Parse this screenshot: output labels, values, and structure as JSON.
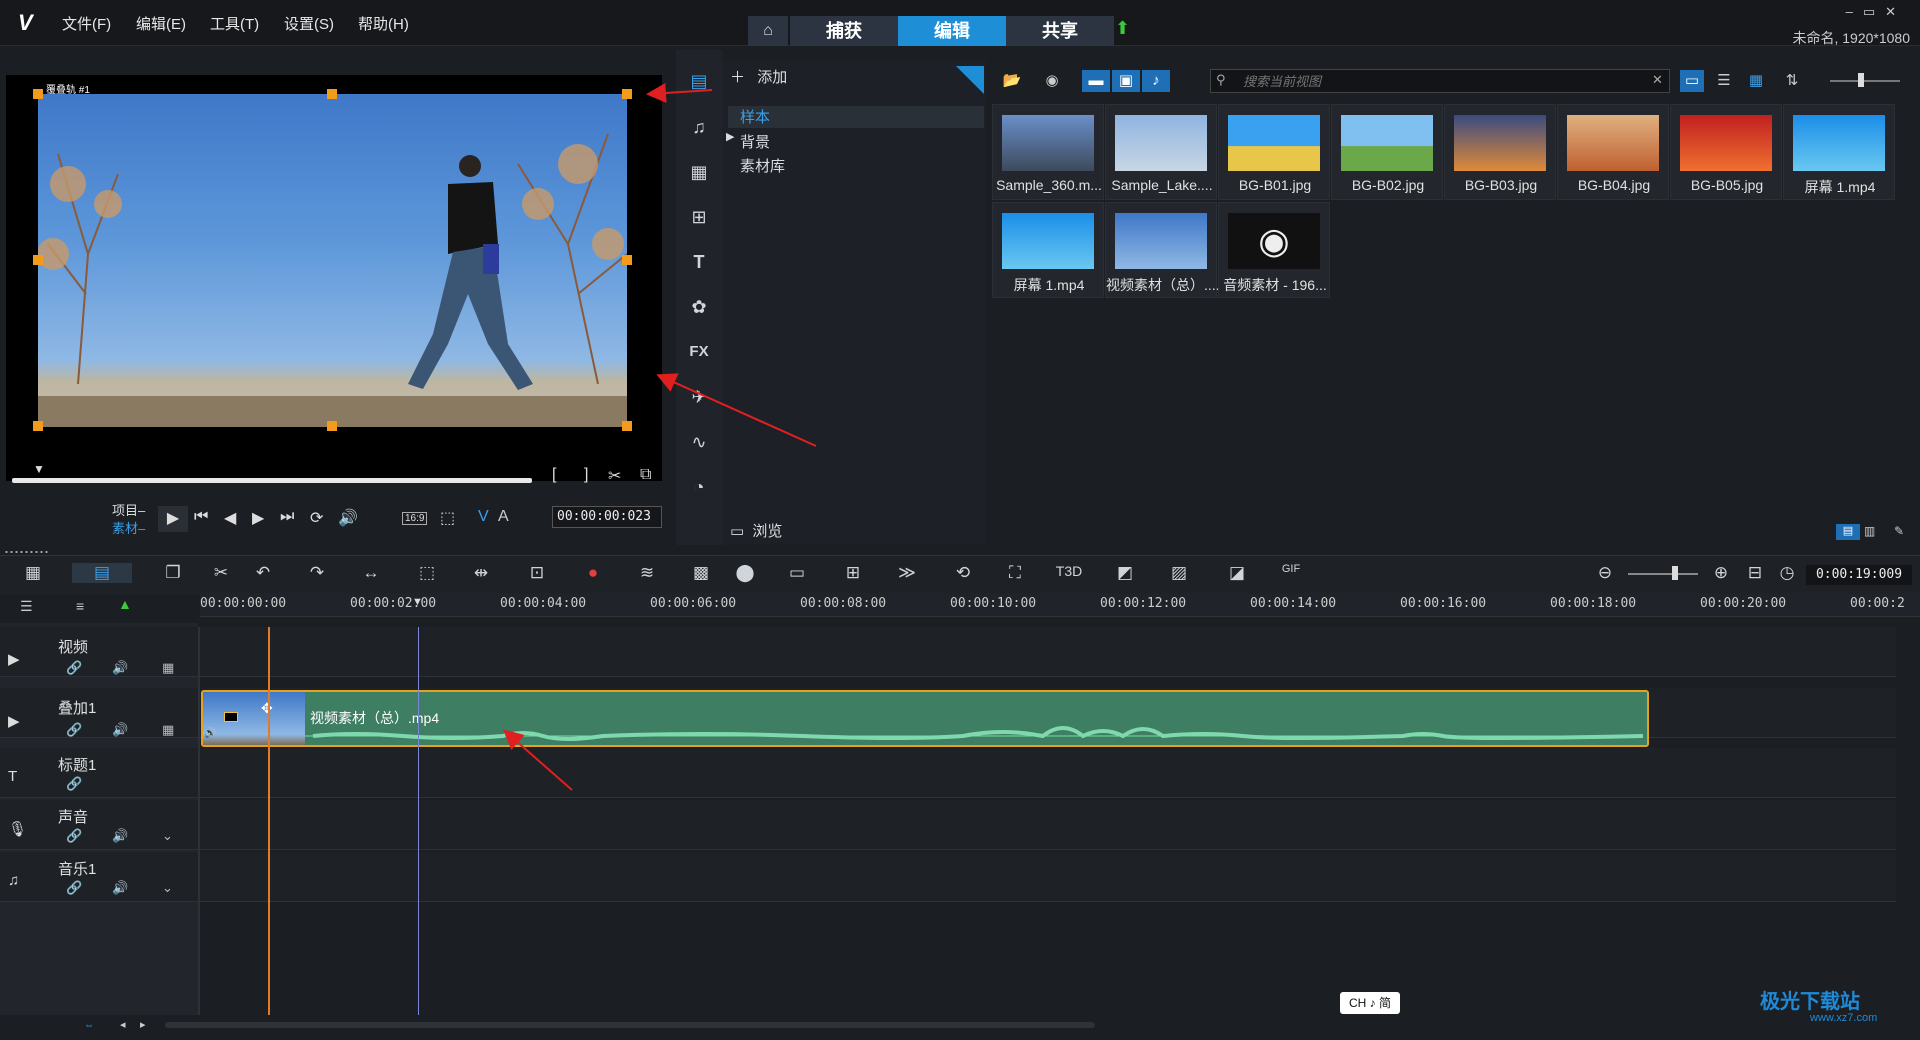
{
  "menu": {
    "file": "文件(F)",
    "edit": "编辑(E)",
    "tools": "工具(T)",
    "settings": "设置(S)",
    "help": "帮助(H)"
  },
  "mode_tabs": {
    "capture": "捕获",
    "edit": "编辑",
    "share": "共享"
  },
  "project_info": "未命名, 1920*1080",
  "player": {
    "overlay_label": "覆叠轨 #1",
    "project_label": "项目–",
    "clip_label": "素材–",
    "timecode": "00:00:00:023",
    "aspect": "16:9"
  },
  "library": {
    "add_label": "添加",
    "tree": [
      "样本",
      "背景",
      "素材库"
    ],
    "browse_label": "浏览",
    "search_placeholder": "搜索当前视图",
    "items": [
      {
        "name": "Sample_360.m...",
        "kind": "video"
      },
      {
        "name": "Sample_Lake....",
        "kind": "video"
      },
      {
        "name": "BG-B01.jpg",
        "kind": "image"
      },
      {
        "name": "BG-B02.jpg",
        "kind": "image"
      },
      {
        "name": "BG-B03.jpg",
        "kind": "image"
      },
      {
        "name": "BG-B04.jpg",
        "kind": "image"
      },
      {
        "name": "BG-B05.jpg",
        "kind": "image"
      },
      {
        "name": "屏幕 1.mp4",
        "kind": "video"
      },
      {
        "name": "屏幕 1.mp4",
        "kind": "video"
      },
      {
        "name": "视频素材（总）....",
        "kind": "video"
      },
      {
        "name": "音频素材 - 196...",
        "kind": "audio"
      }
    ]
  },
  "timeline": {
    "duration": "0:00:19:009",
    "ruler": [
      "00:00:00:00",
      "00:00:02:00",
      "00:00:04:00",
      "00:00:06:00",
      "00:00:08:00",
      "00:00:10:00",
      "00:00:12:00",
      "00:00:14:00",
      "00:00:16:00",
      "00:00:18:00",
      "00:00:20:00",
      "00:00:2"
    ],
    "tracks": {
      "video": "视频",
      "overlay": "叠加1",
      "title": "标题1",
      "voice": "声音",
      "music": "音乐1"
    },
    "clip_name": "视频素材（总）.mp4"
  },
  "ime": "CH ♪ 简",
  "watermark": {
    "name": "极光下载站",
    "url": "www.xz7.com"
  }
}
